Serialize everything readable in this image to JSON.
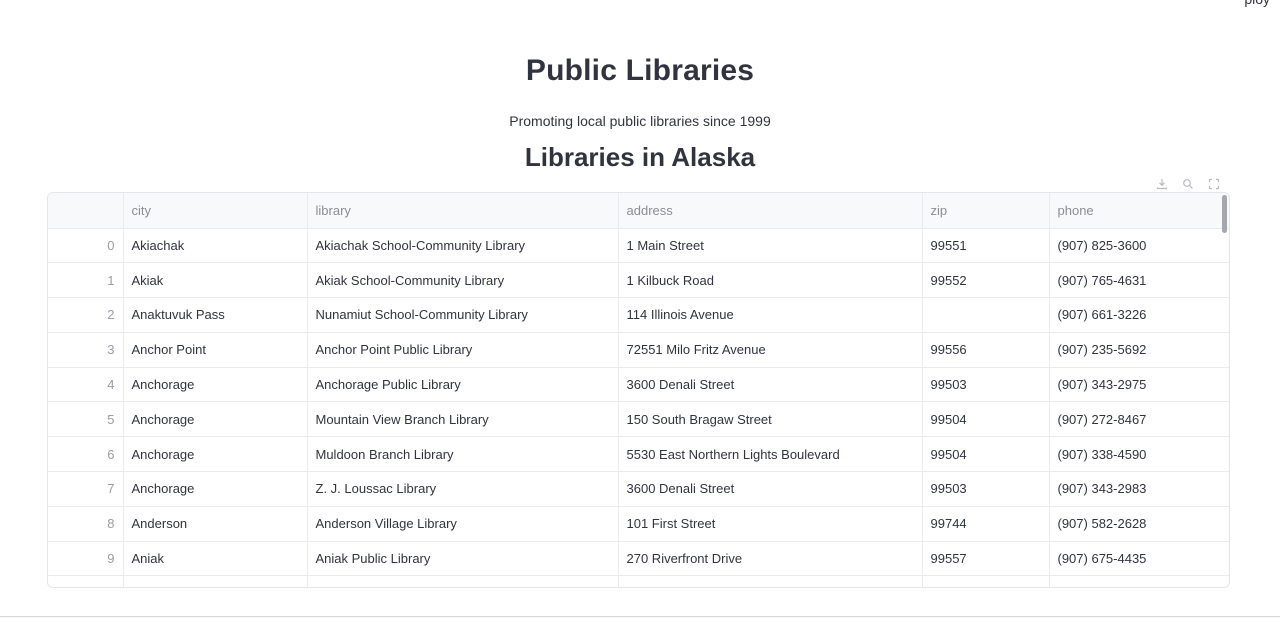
{
  "header": {
    "corner_text": "ploy"
  },
  "page": {
    "title": "Public Libraries",
    "subtitle": "Promoting local public libraries since 1999",
    "section_title": "Libraries in Alaska"
  },
  "toolbar": {
    "icons": [
      "download-icon",
      "search-icon",
      "fullscreen-icon"
    ]
  },
  "table": {
    "columns": [
      "",
      "city",
      "library",
      "address",
      "zip",
      "phone"
    ],
    "rows": [
      [
        "0",
        "Akiachak",
        "Akiachak School-Community Library",
        "1 Main Street",
        "99551",
        "(907) 825-3600"
      ],
      [
        "1",
        "Akiak",
        "Akiak School-Community Library",
        "1 Kilbuck Road",
        "99552",
        "(907) 765-4631"
      ],
      [
        "2",
        "Anaktuvuk Pass",
        "Nunamiut School-Community Library",
        "114 Illinois Avenue",
        "",
        "(907) 661-3226"
      ],
      [
        "3",
        "Anchor Point",
        "Anchor Point Public Library",
        "72551 Milo Fritz Avenue",
        "99556",
        "(907) 235-5692"
      ],
      [
        "4",
        "Anchorage",
        "Anchorage Public Library",
        "3600 Denali Street",
        "99503",
        "(907) 343-2975"
      ],
      [
        "5",
        "Anchorage",
        "Mountain View Branch Library",
        "150 South Bragaw Street",
        "99504",
        "(907) 272-8467"
      ],
      [
        "6",
        "Anchorage",
        "Muldoon Branch Library",
        "5530 East Northern Lights Boulevard",
        "99504",
        "(907) 338-4590"
      ],
      [
        "7",
        "Anchorage",
        "Z. J. Loussac Library",
        "3600 Denali Street",
        "99503",
        "(907) 343-2983"
      ],
      [
        "8",
        "Anderson",
        "Anderson Village Library",
        "101 First Street",
        "99744",
        "(907) 582-2628"
      ],
      [
        "9",
        "Aniak",
        "Aniak Public Library",
        "270 Riverfront Drive",
        "99557",
        "(907) 675-4435"
      ]
    ]
  },
  "colors": {
    "text": "#31333f",
    "header_bg": "#f8f9fb",
    "border": "#ebebef"
  }
}
